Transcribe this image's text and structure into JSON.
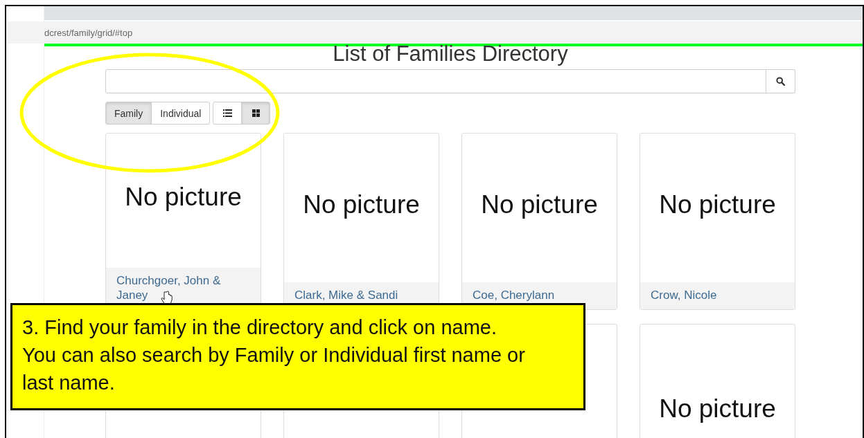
{
  "browser": {
    "url": "dcrest/family/grid/#top"
  },
  "page": {
    "title": "List of Families Directory",
    "mode_toggle": [
      {
        "label": "Family",
        "selected": true
      },
      {
        "label": "Individual",
        "selected": false
      }
    ],
    "view_toggle": [
      {
        "kind": "list",
        "selected": false
      },
      {
        "kind": "grid",
        "selected": true
      }
    ],
    "cards": [
      {
        "kind": "picture",
        "picture_text": "No picture",
        "name": "Churchgoer, John & Janey"
      },
      {
        "kind": "picture",
        "picture_text": "No picture",
        "name": "Clark, Mike & Sandi"
      },
      {
        "kind": "picture",
        "picture_text": "No picture",
        "name": "Coe, Cherylann"
      },
      {
        "kind": "picture",
        "picture_text": "No picture",
        "name": "Crow, Nicole"
      },
      {
        "kind": "covered"
      },
      {
        "kind": "covered"
      },
      {
        "kind": "covered"
      },
      {
        "kind": "picture",
        "picture_text": "No picture"
      }
    ]
  },
  "annotation": {
    "text": "3. Find your family in the directory and click on name. You can also search by Family or Individual first name or last name."
  }
}
